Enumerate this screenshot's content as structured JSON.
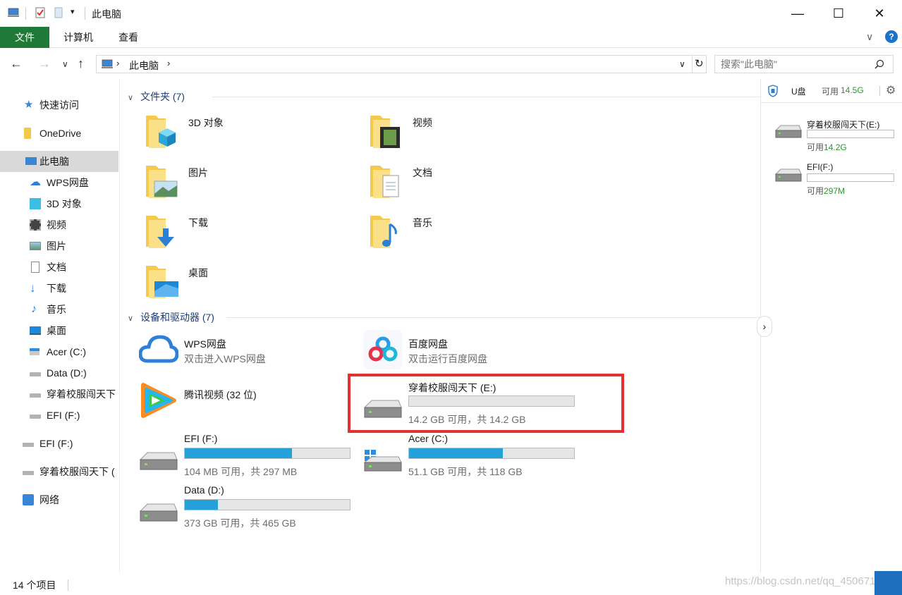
{
  "window": {
    "title": "此电脑",
    "minimize_glyph": "—",
    "maximize_glyph": "☐",
    "close_glyph": "✕"
  },
  "ribbon": {
    "tabs": [
      "文件",
      "计算机",
      "查看"
    ],
    "expand_glyph": "∨",
    "help_glyph": "?"
  },
  "address": {
    "path": "此电脑",
    "search_placeholder": "搜索\"此电脑\""
  },
  "sidebar": {
    "items": [
      {
        "label": "快速访问",
        "icon": "star-icon"
      },
      {
        "label": "OneDrive",
        "icon": "folder-icon"
      },
      {
        "label": "此电脑",
        "icon": "computer-icon",
        "selected": true
      },
      {
        "label": "WPS网盘",
        "icon": "cloud-icon"
      },
      {
        "label": "3D 对象",
        "icon": "cube-icon"
      },
      {
        "label": "视频",
        "icon": "film-icon"
      },
      {
        "label": "图片",
        "icon": "picture-icon"
      },
      {
        "label": "文档",
        "icon": "document-icon"
      },
      {
        "label": "下载",
        "icon": "download-icon"
      },
      {
        "label": "音乐",
        "icon": "music-icon"
      },
      {
        "label": "桌面",
        "icon": "desktop-icon"
      },
      {
        "label": "Acer (C:)",
        "icon": "windows-drive-icon"
      },
      {
        "label": "Data (D:)",
        "icon": "drive-icon"
      },
      {
        "label": "穿着校服闯天下",
        "icon": "drive-icon"
      },
      {
        "label": "EFI (F:)",
        "icon": "drive-icon"
      },
      {
        "label": "EFI (F:)",
        "icon": "drive-icon"
      },
      {
        "label": "穿着校服闯天下 (",
        "icon": "drive-icon"
      },
      {
        "label": "网络",
        "icon": "network-icon"
      }
    ]
  },
  "content": {
    "folders_header": "文件夹 (7)",
    "folders": [
      {
        "label": "3D 对象",
        "icon": "cube-folder-icon"
      },
      {
        "label": "视频",
        "icon": "video-folder-icon"
      },
      {
        "label": "图片",
        "icon": "picture-folder-icon"
      },
      {
        "label": "文档",
        "icon": "document-folder-icon"
      },
      {
        "label": "下载",
        "icon": "download-folder-icon"
      },
      {
        "label": "音乐",
        "icon": "music-folder-icon"
      },
      {
        "label": "桌面",
        "icon": "desktop-folder-icon"
      }
    ],
    "devices_header": "设备和驱动器 (7)",
    "apps": [
      {
        "name": "WPS网盘",
        "sub": "双击进入WPS网盘",
        "icon": "wps-cloud-icon"
      },
      {
        "name": "百度网盘",
        "sub": "双击运行百度网盘",
        "icon": "baidu-netdisk-icon"
      },
      {
        "name": "腾讯视频 (32 位)",
        "sub": "",
        "icon": "tencent-video-icon"
      }
    ],
    "drives": [
      {
        "name": "穿着校服闯天下 (E:)",
        "space": "14.2 GB 可用，共 14.2 GB",
        "used_fraction": 0.0,
        "icon": "drive-icon"
      },
      {
        "name": "EFI (F:)",
        "space": "104 MB 可用，共 297 MB",
        "used_fraction": 0.65,
        "icon": "drive-icon"
      },
      {
        "name": "Acer (C:)",
        "space": "51.1 GB 可用，共 118 GB",
        "used_fraction": 0.57,
        "icon": "windows-drive-icon"
      },
      {
        "name": "Data (D:)",
        "space": "373 GB 可用，共 465 GB",
        "used_fraction": 0.2,
        "icon": "drive-icon"
      }
    ]
  },
  "right_panel": {
    "title": "U盘",
    "avail_label": "可用",
    "avail_value": "14.5G",
    "drives": [
      {
        "name": "穿着校服闯天下(E:)",
        "avail_label": "可用",
        "avail_value": "14.2G"
      },
      {
        "name": "EFI(F:)",
        "avail_label": "可用",
        "avail_value": "297M"
      }
    ]
  },
  "status": {
    "count": "14 个项目"
  },
  "watermark": "https://blog.csdn.net/qq_45‍‍‍‍0671",
  "colors": {
    "file_tab": "#1f7a37",
    "bar_fill": "#26a0da",
    "highlight_box": "#e8302f",
    "selection": "#d9d9d9"
  }
}
